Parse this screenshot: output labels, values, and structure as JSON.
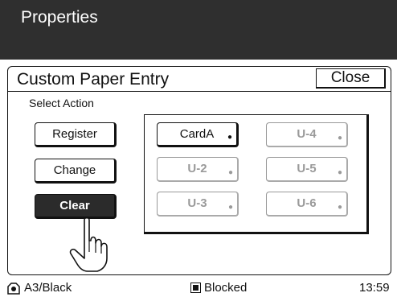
{
  "header": {
    "title": "Properties"
  },
  "dialog": {
    "title": "Custom Paper Entry",
    "close_label": "Close"
  },
  "actions": {
    "label": "Select Action",
    "register": "Register",
    "change": "Change",
    "clear": "Clear",
    "selected": "Clear"
  },
  "papers": [
    {
      "label": "CardA",
      "enabled": true
    },
    {
      "label": "U-2",
      "enabled": false
    },
    {
      "label": "U-3",
      "enabled": false
    },
    {
      "label": "U-4",
      "enabled": false
    },
    {
      "label": "U-5",
      "enabled": false
    },
    {
      "label": "U-6",
      "enabled": false
    }
  ],
  "status": {
    "paper": "A3/Black",
    "state": "Blocked",
    "time": "13:59"
  },
  "icons": [
    "printer-icon",
    "square-icon",
    "hand-pointer-icon"
  ]
}
